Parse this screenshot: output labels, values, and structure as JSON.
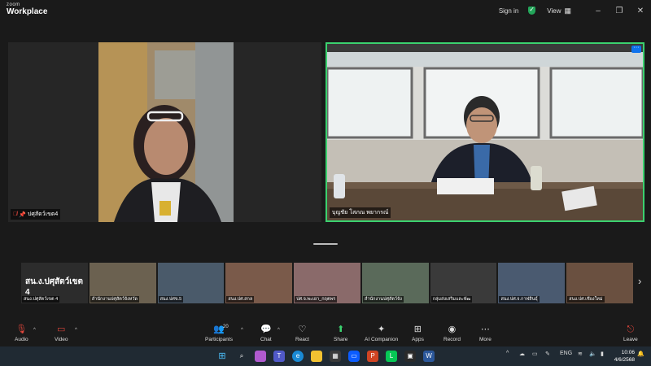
{
  "app": {
    "brand_small": "zoom",
    "brand_big": "Workplace"
  },
  "titlebar": {
    "signin": "Sign in",
    "view": "View"
  },
  "tiles": {
    "left": {
      "name": "ปศุสัตว์เขต4"
    },
    "right": {
      "name": "บุญชัย โสภณ พยากรณ์"
    }
  },
  "filmstrip": {
    "first_label": "สน.ง.ปศุสัตว์เขต 4",
    "first_name": "สนง.ปศุสัตว์เขต 4",
    "items": [
      {
        "name": "สำนักงานปศุสัตว์จังหวัด",
        "color": "#6b6150"
      },
      {
        "name": "สนง.ปศข.5",
        "color": "#4a5a6a"
      },
      {
        "name": "สนง.ปศ.สกล",
        "color": "#7a5a4a"
      },
      {
        "name": "ปศ.จ.พะเยา_กฤตพร",
        "color": "#8a6a6a"
      },
      {
        "name": "สำนักงานปศุสัตว์จัง",
        "color": "#5a6a5a"
      },
      {
        "name": "กลุ่มส่งเสริมและพัฒ",
        "color": "#3a3a3a"
      },
      {
        "name": "สนง.ปศ.จ.กาฬสินธุ์",
        "color": "#4a5a70"
      },
      {
        "name": "สนง.ปศ.เชียงใหม่",
        "color": "#6a5040"
      }
    ]
  },
  "controls": {
    "audio": "Audio",
    "video": "Video",
    "participants": "Participants",
    "participants_count": "20",
    "chat": "Chat",
    "react": "React",
    "share": "Share",
    "ai": "AI Companion",
    "apps": "Apps",
    "record": "Record",
    "more": "More",
    "leave": "Leave"
  },
  "taskbar": {
    "lang": "ENG",
    "time": "10:06",
    "date": "4/6/2568"
  }
}
